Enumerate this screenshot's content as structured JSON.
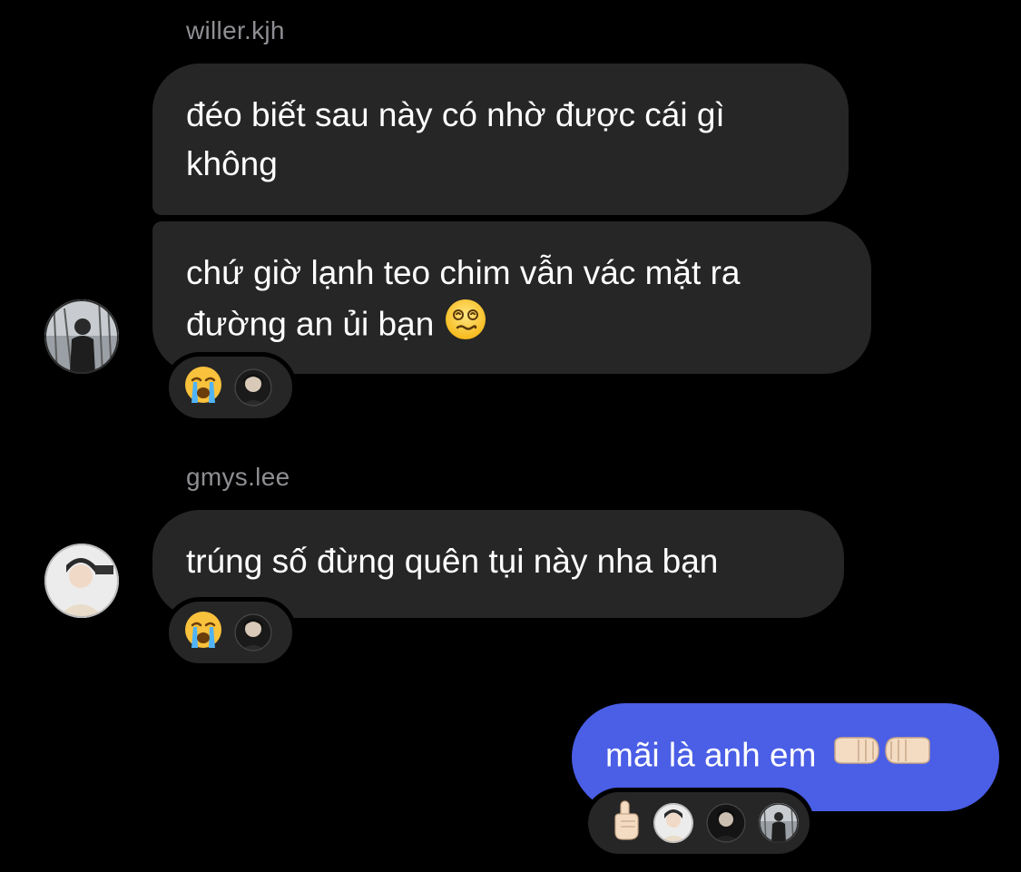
{
  "conversation": {
    "group1": {
      "username": "willer.kjh",
      "messages": [
        {
          "text_line1": "đéo biết sau này có nhờ được cái gì",
          "text_line2": "không"
        },
        {
          "text_line1": "chứ giờ lạnh teo chim vẫn vác mặt ra",
          "text_line2": "đường an ủi bạn",
          "emoji": "dizzy-face-emoji"
        }
      ],
      "reaction": {
        "emoji": "😭",
        "emoji_name": "loudly-crying-face"
      }
    },
    "group2": {
      "username": "gmys.lee",
      "messages": [
        {
          "text": "trúng số đừng quên tụi này nha bạn"
        }
      ],
      "reaction": {
        "emoji": "😭",
        "emoji_name": "loudly-crying-face"
      }
    },
    "outgoing": {
      "text": "mãi là anh em",
      "emoji": "fist-bump-emoji",
      "reaction": {
        "emoji_name": "pointing-up-hand"
      }
    }
  },
  "colors": {
    "background": "#000000",
    "incoming_bubble": "#262626",
    "outgoing_bubble": "#4a5ee6",
    "username": "#8e8e93"
  }
}
